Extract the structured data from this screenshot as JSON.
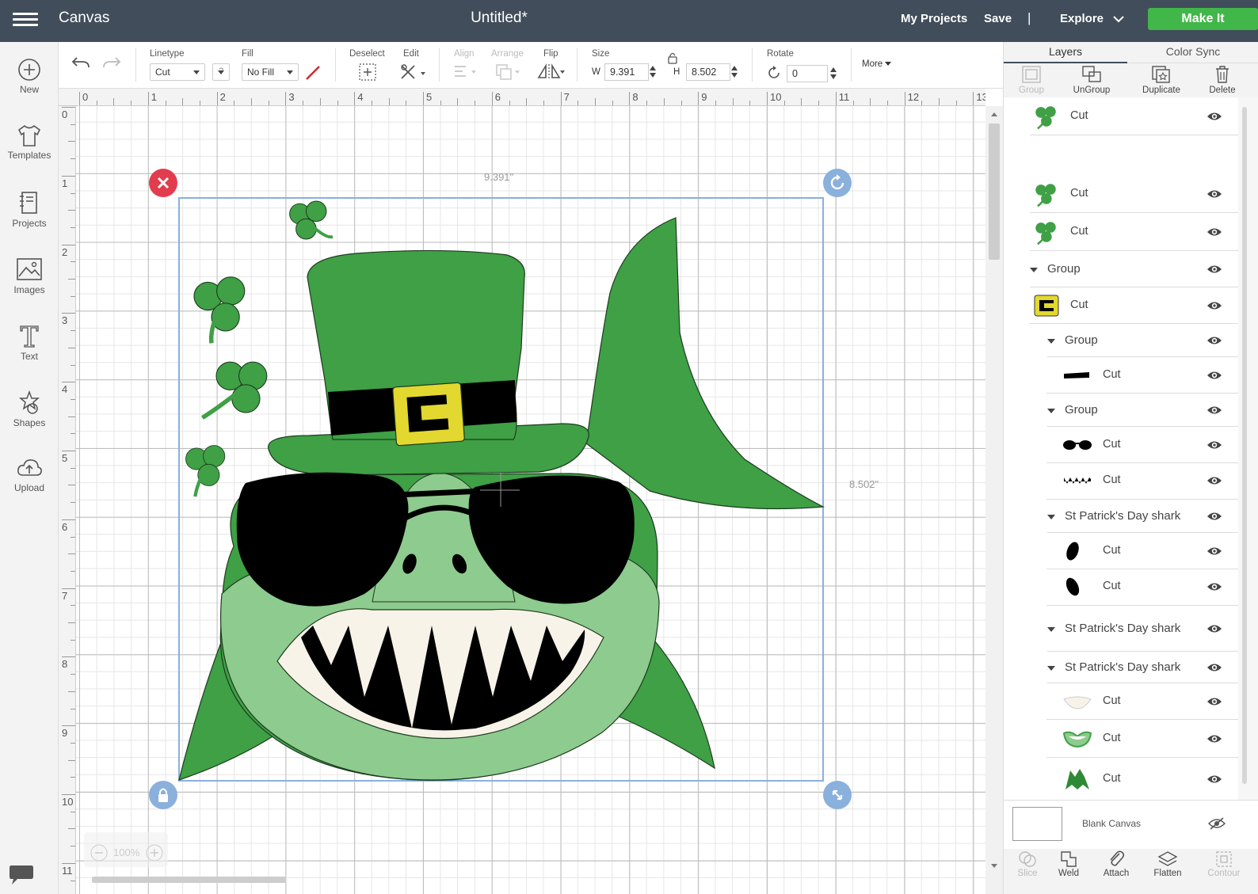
{
  "topbar": {
    "app_title": "Canvas",
    "doc_title": "Untitled*",
    "my_projects": "My Projects",
    "save": "Save",
    "separator": "|",
    "explore": "Explore",
    "make_it": "Make It"
  },
  "leftbar": {
    "items": [
      {
        "label": "New",
        "icon": "plus-circle-icon"
      },
      {
        "label": "Templates",
        "icon": "tshirt-icon"
      },
      {
        "label": "Projects",
        "icon": "notebook-icon"
      },
      {
        "label": "Images",
        "icon": "image-icon"
      },
      {
        "label": "Text",
        "icon": "text-icon"
      },
      {
        "label": "Shapes",
        "icon": "shapes-icon"
      },
      {
        "label": "Upload",
        "icon": "cloud-upload-icon"
      }
    ]
  },
  "toolbar": {
    "linetype_label": "Linetype",
    "linetype_value": "Cut",
    "help": "?",
    "fill_label": "Fill",
    "fill_value": "No Fill",
    "deselect_label": "Deselect",
    "edit_label": "Edit",
    "align_label": "Align",
    "arrange_label": "Arrange",
    "flip_label": "Flip",
    "size_label": "Size",
    "w_label": "W",
    "w_value": "9.391",
    "h_label": "H",
    "h_value": "8.502",
    "rotate_label": "Rotate",
    "rotate_value": "0",
    "more_label": "More"
  },
  "rulers": {
    "top": [
      "0",
      "1",
      "2",
      "3",
      "4",
      "5",
      "6",
      "7",
      "8",
      "9",
      "10",
      "11",
      "12",
      "13"
    ],
    "left": [
      "0",
      "1",
      "2",
      "3",
      "4",
      "5",
      "6",
      "7",
      "8",
      "9",
      "10",
      "11"
    ]
  },
  "canvas": {
    "width_label": "9.391\"",
    "height_label": "8.502\"",
    "zoom": "100%",
    "accent_red": "#e23d4e",
    "accent_blue": "#8ab0dc"
  },
  "panel": {
    "tabs": [
      "Layers",
      "Color Sync"
    ],
    "actions": [
      "Group",
      "UnGroup",
      "Duplicate",
      "Delete"
    ],
    "layers": [
      {
        "label": "Cut",
        "indent": 0,
        "thumb": "shamrock"
      },
      {
        "label": "Cut",
        "indent": 0,
        "thumb": "shamrock"
      },
      {
        "label": "Cut",
        "indent": 0,
        "thumb": "shamrock"
      },
      {
        "label": "Group",
        "indent": 0,
        "group": true
      },
      {
        "label": "Cut",
        "indent": 0,
        "thumb": "buckle"
      },
      {
        "label": "Group",
        "indent": 1,
        "group": true
      },
      {
        "label": "Cut",
        "indent": 1,
        "thumb": "band"
      },
      {
        "label": "Group",
        "indent": 1,
        "group": true
      },
      {
        "label": "Cut",
        "indent": 1,
        "thumb": "glasses"
      },
      {
        "label": "Cut",
        "indent": 1,
        "thumb": "teeth"
      },
      {
        "label": "St Patrick's Day shark",
        "indent": 1,
        "group": true
      },
      {
        "label": "Cut",
        "indent": 1,
        "thumb": "eye1"
      },
      {
        "label": "Cut",
        "indent": 1,
        "thumb": "eye2"
      },
      {
        "label": "St Patrick's Day shark",
        "indent": 1,
        "group": true
      },
      {
        "label": "St Patrick's Day shark",
        "indent": 1,
        "group": true
      },
      {
        "label": "Cut",
        "indent": 1,
        "thumb": "mouth"
      },
      {
        "label": "Cut",
        "indent": 1,
        "thumb": "lip"
      },
      {
        "label": "Cut",
        "indent": 1,
        "thumb": "body"
      }
    ],
    "blank_canvas": "Blank Canvas",
    "bottom_actions": [
      "Slice",
      "Weld",
      "Attach",
      "Flatten",
      "Contour"
    ]
  }
}
